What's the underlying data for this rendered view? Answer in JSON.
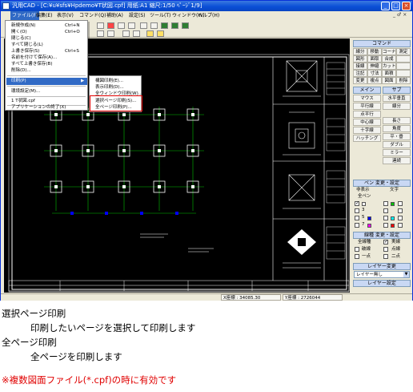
{
  "window": {
    "title": "汎用CAD - [C:¥u¥sfs¥Hpdemo¥T状図.cpf]  用紙:A1  縮尺:1/50 ﾍﾟｰｼﾞ1/9]",
    "min_glyph": "_",
    "max_glyph": "□",
    "close_glyph": "×"
  },
  "menubar": {
    "items": [
      "ファイル(F)",
      "編集(E)",
      "表示(V)",
      "コマンド(Q)",
      "補助(A)",
      "設定(S)",
      "ツール(T)",
      "ウィンドウ(W)",
      "ヘルプ(H)"
    ],
    "mdi_controls": "_ ♂ ×"
  },
  "file_menu": {
    "items": [
      {
        "label": "新規作成(N)",
        "shortcut": "Ctrl+N"
      },
      {
        "label": "開く(O)",
        "shortcut": "Ctrl+O"
      },
      {
        "label": "閉じる(C)",
        "shortcut": ""
      },
      {
        "label": "すべて閉じる(L)",
        "shortcut": ""
      },
      {
        "label": "上書き保存(S)",
        "shortcut": "Ctrl+S"
      },
      {
        "label": "名前を付けて保存(A)...",
        "shortcut": ""
      },
      {
        "label": "すべて上書き保存(B)",
        "shortcut": ""
      },
      {
        "label": "削除(D)...",
        "shortcut": ""
      },
      {
        "label": "印刷(P)",
        "shortcut": "▶"
      },
      {
        "label": "環境設定(M)...",
        "shortcut": ""
      },
      {
        "label": "1 T状図.cpf",
        "shortcut": ""
      },
      {
        "label": "アプリケーションの終了(X)",
        "shortcut": ""
      }
    ]
  },
  "print_submenu": {
    "items": [
      {
        "label": "構図印刷(E)..."
      },
      {
        "label": "表示印刷(D)..."
      },
      {
        "label": "全ウィンドウ印刷(W)..."
      },
      {
        "label": "選択ページ印刷(S)..."
      },
      {
        "label": "全ページ印刷(P)..."
      }
    ]
  },
  "panel": {
    "command_title": "コマンド",
    "command_rows": [
      [
        "線分",
        "移動",
        "コーナー",
        "測定"
      ],
      [
        "図形",
        "面取",
        "合成",
        ""
      ],
      [
        "接線",
        "伸縮",
        "カット",
        ""
      ],
      [
        "注記",
        "寸法",
        "面積",
        ""
      ],
      [
        "変更",
        "複点",
        "図面",
        "削除"
      ]
    ],
    "main_title": "メイン",
    "sub_title": "サブ",
    "main_buttons": [
      "マウス",
      "平行線",
      "点平行",
      "中心線",
      "十字線",
      "ハッチング"
    ],
    "sub_buttons": [
      "水平垂直",
      "線分",
      "長さ",
      "角度",
      "平・垂",
      "ダブル",
      "ミラー",
      "連続"
    ],
    "pen_title": "ペン 変更・設定",
    "pen_header": [
      "非表示",
      "文字"
    ],
    "pen_all": "全ペン",
    "pen_numbers": [
      "1",
      "3",
      "5",
      "7"
    ],
    "pen_colors": [
      "#ffffff",
      "#00c000",
      "#0000ff",
      "#ff00ff",
      "#ff0000",
      "#00ffff",
      "#ffff00",
      "#c0c0c0"
    ],
    "linetype_title": "線種 変更・設定",
    "linetype_items": [
      "全線種",
      "実線",
      "破線",
      "点線",
      "一点",
      "二点"
    ],
    "layer_title": "レイヤー変更",
    "layer_value": "レイヤー無し",
    "layer_set_label": "レイヤー設定"
  },
  "statusbar": {
    "x_coord": "X座標 : 34085.30",
    "y_coord": "Y座標 : 2726044"
  },
  "captions": {
    "line1": "選択ページ印刷",
    "line2": "印刷したいページを選択して印刷します",
    "line3": "全ページ印刷",
    "line4": "全ページを印刷します",
    "note": "※複数図面ファイル(*.cpf)の時に有効です"
  },
  "colors": {
    "accent_red": "#e00000",
    "menu_highlight": "#316ac5",
    "titlebar_blue": "#0a4fd6",
    "canvas_bg": "#000000",
    "drawing_white": "#ffffff",
    "drawing_green": "#00c000"
  }
}
